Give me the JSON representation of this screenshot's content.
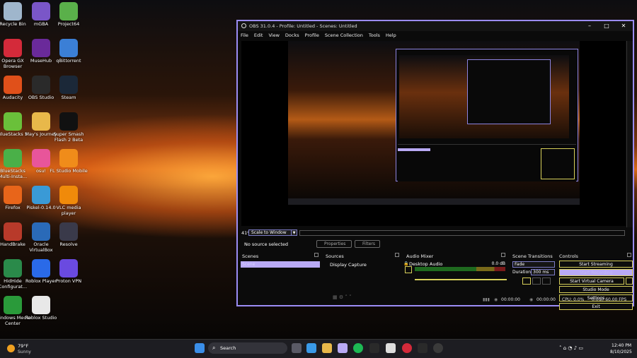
{
  "desktop_icons": [
    {
      "label": "Recycle Bin",
      "icon": "recycle-bin-icon",
      "color": "#9fb6cc"
    },
    {
      "label": "mGBA",
      "icon": "mgba-icon",
      "color": "#7a56c8"
    },
    {
      "label": "Project64",
      "icon": "project64-icon",
      "color": "#5ab04a"
    },
    {
      "label": "Opera GX Browser",
      "icon": "opera-gx-icon",
      "color": "#d42a3a"
    },
    {
      "label": "MuseHub",
      "icon": "musehub-icon",
      "color": "#6a2a9a"
    },
    {
      "label": "qBittorrent",
      "icon": "qbittorrent-icon",
      "color": "#3b7fd6"
    },
    {
      "label": "Audacity",
      "icon": "audacity-icon",
      "color": "#e0501a"
    },
    {
      "label": "OBS Studio",
      "icon": "obs-icon",
      "color": "#2a2a2a"
    },
    {
      "label": "Steam",
      "icon": "steam-icon",
      "color": "#1b2838"
    },
    {
      "label": "BlueStacks 5",
      "icon": "bluestacks-icon",
      "color": "#6ac03a"
    },
    {
      "label": "May's Journey",
      "icon": "folder-icon",
      "color": "#e8b84a"
    },
    {
      "label": "Super Smash Flash 2 Beta",
      "icon": "ssf2-icon",
      "color": "#111111"
    },
    {
      "label": "BlueStacks Multi-Insta...",
      "icon": "bluestacks-multi-icon",
      "color": "#4ab048"
    },
    {
      "label": "osu!",
      "icon": "osu-icon",
      "color": "#e8559a"
    },
    {
      "label": "FL Studio Mobile",
      "icon": "fl-studio-icon",
      "color": "#f08c1a"
    },
    {
      "label": "Firefox",
      "icon": "firefox-icon",
      "color": "#e8651a"
    },
    {
      "label": "Piskel-0.14.0",
      "icon": "piskel-icon",
      "color": "#3a9ad6"
    },
    {
      "label": "VLC media player",
      "icon": "vlc-icon",
      "color": "#f08a0a"
    },
    {
      "label": "HandBrake",
      "icon": "handbrake-icon",
      "color": "#b83a2a"
    },
    {
      "label": "Oracle VirtualBox",
      "icon": "virtualbox-icon",
      "color": "#2a6ab8"
    },
    {
      "label": "Resolve",
      "icon": "resolve-icon",
      "color": "#3a3a4a"
    },
    {
      "label": "HidHide Configurat...",
      "icon": "hidhide-icon",
      "color": "#2a8a4a"
    },
    {
      "label": "Roblox Player",
      "icon": "roblox-player-icon",
      "color": "#2a6ae8"
    },
    {
      "label": "Proton VPN",
      "icon": "proton-vpn-icon",
      "color": "#6a4ae0"
    },
    {
      "label": "Windows Media Center",
      "icon": "media-center-icon",
      "color": "#2a9a3a"
    },
    {
      "label": "Roblox Studio",
      "icon": "roblox-studio-icon",
      "color": "#e8e8e8"
    }
  ],
  "obs": {
    "title": "OBS 31.0.4 - Profile: Untitled - Scenes: Untitled",
    "menu": [
      "File",
      "Edit",
      "View",
      "Docks",
      "Profile",
      "Scene Collection",
      "Tools",
      "Help"
    ],
    "zoom": "41%",
    "scale_mode": "Scale to Window",
    "no_source": "No source selected",
    "properties_label": "Properties",
    "filters_label": "Filters",
    "docks": {
      "scenes": {
        "title": "Scenes",
        "items": [
          "Scene"
        ]
      },
      "sources": {
        "title": "Sources",
        "items": [
          "Display Capture"
        ]
      },
      "mixer": {
        "title": "Audio Mixer",
        "channel": "Desktop Audio",
        "level": "0.0 dB"
      },
      "transitions": {
        "title": "Scene Transitions",
        "type": "Fade",
        "duration_label": "Duration",
        "duration": "300 ms"
      },
      "controls": {
        "title": "Controls",
        "buttons": [
          "Start Streaming",
          "Start Recording",
          "Start Virtual Camera",
          "Studio Mode",
          "Settings",
          "Exit"
        ]
      }
    },
    "status": {
      "rec_time": "00:00:00",
      "stream_time": "00:00:00",
      "cpu": "CPU: 0.0%",
      "fps": "0.00 / 60.00 FPS"
    }
  },
  "taskbar": {
    "weather_temp": "79°F",
    "weather_desc": "Sunny",
    "search": "Search",
    "time": "12:40 PM",
    "date": "8/10/2025"
  }
}
